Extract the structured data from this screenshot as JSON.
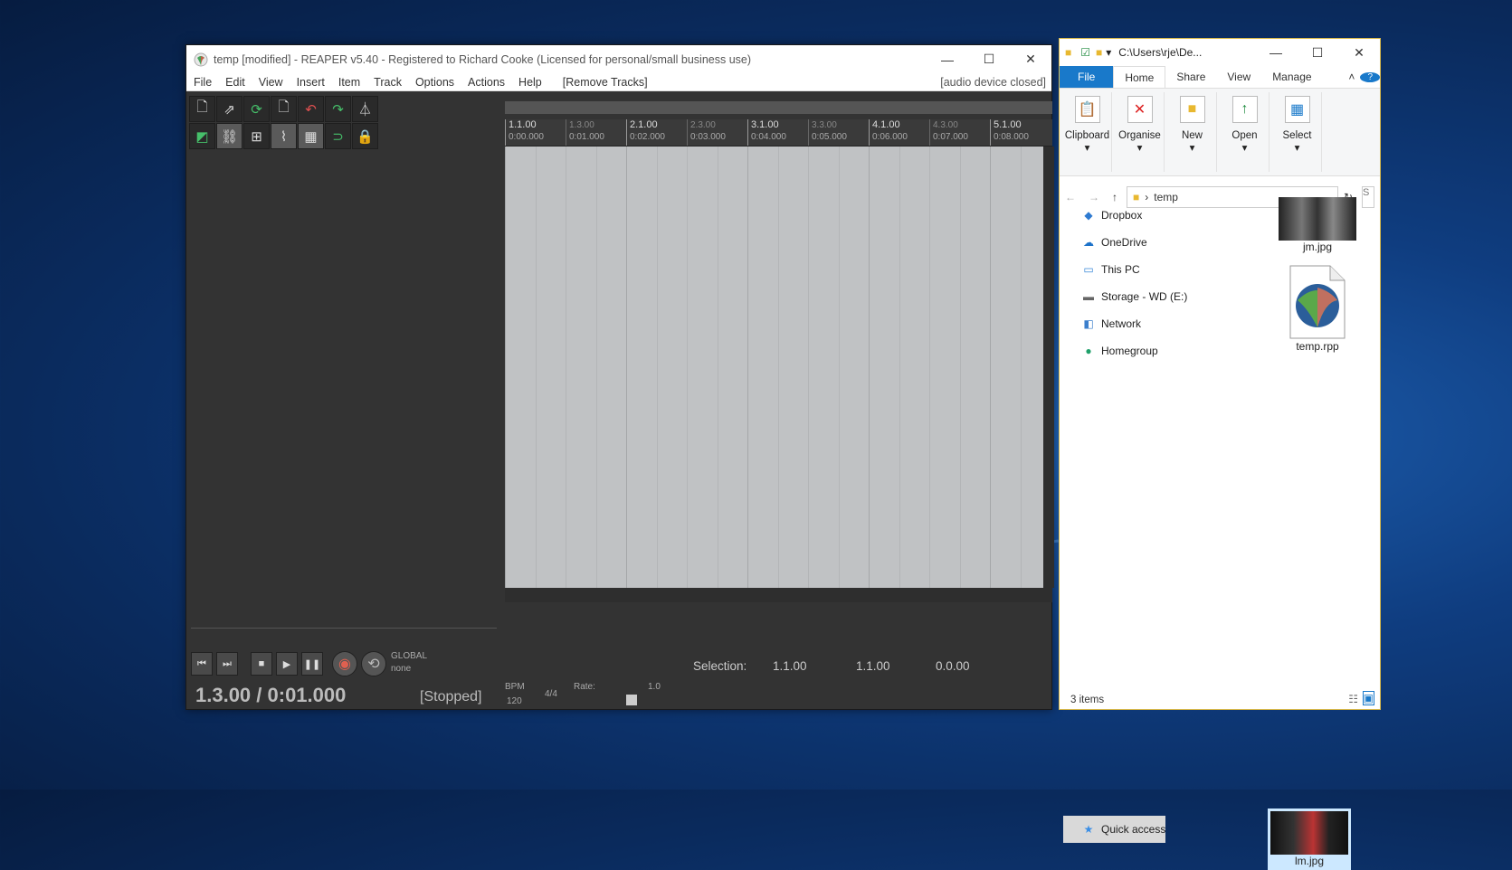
{
  "reaper": {
    "title": "temp [modified] - REAPER v5.40 - Registered to Richard Cooke (Licensed for personal/small business use)",
    "menu": [
      "File",
      "Edit",
      "View",
      "Insert",
      "Item",
      "Track",
      "Options",
      "Actions",
      "Help"
    ],
    "remove_tracks": "[Remove Tracks]",
    "audio_device": "[audio device closed]",
    "ruler": [
      {
        "bar": "1.1.00",
        "time": "0:00.000",
        "minor": false
      },
      {
        "bar": "1.3.00",
        "time": "0:01.000",
        "minor": true
      },
      {
        "bar": "2.1.00",
        "time": "0:02.000",
        "minor": false
      },
      {
        "bar": "2.3.00",
        "time": "0:03.000",
        "minor": true
      },
      {
        "bar": "3.1.00",
        "time": "0:04.000",
        "minor": false
      },
      {
        "bar": "3.3.00",
        "time": "0:05.000",
        "minor": true
      },
      {
        "bar": "4.1.00",
        "time": "0:06.000",
        "minor": false
      },
      {
        "bar": "4.3.00",
        "time": "0:07.000",
        "minor": true
      },
      {
        "bar": "5.1.00",
        "time": "0:08.000",
        "minor": false
      }
    ],
    "position": "1.3.00 / 0:01.000",
    "state": "[Stopped]",
    "global_label": "GLOBAL",
    "global_value": "none",
    "bpm_label": "BPM",
    "bpm": "120",
    "time_sig": "4/4",
    "rate_label": "Rate:",
    "rate": "1.0",
    "selection_label": "Selection:",
    "sel_start": "1.1.00",
    "sel_end": "1.1.00",
    "sel_len": "0.0.00"
  },
  "explorer": {
    "path": "C:\\Users\\rje\\De...",
    "tabs": [
      "File",
      "Home",
      "Share",
      "View",
      "Manage"
    ],
    "ribbon": [
      "Clipboard",
      "Organise",
      "New",
      "Open",
      "Select"
    ],
    "address": "temp",
    "nav": [
      {
        "label": "Quick access",
        "icon": "star-icon",
        "glyph": "★",
        "color": "#3a8ee6"
      },
      {
        "label": "Dropbox",
        "icon": "dropbox-icon",
        "glyph": "◆",
        "color": "#2e7ad1"
      },
      {
        "label": "OneDrive",
        "icon": "cloud-icon",
        "glyph": "☁",
        "color": "#1c72c9"
      },
      {
        "label": "This PC",
        "icon": "computer-icon",
        "glyph": "▭",
        "color": "#3b88d8"
      },
      {
        "label": "Storage - WD (E:)",
        "icon": "drive-icon",
        "glyph": "▬",
        "color": "#666666"
      },
      {
        "label": "Network",
        "icon": "network-icon",
        "glyph": "◧",
        "color": "#3b7fcc"
      },
      {
        "label": "Homegroup",
        "icon": "homegroup-icon",
        "glyph": "●",
        "color": "#1fa06a"
      }
    ],
    "files": [
      "jm.jpg",
      "lm.jpg",
      "temp.rpp"
    ],
    "status": "3 items"
  },
  "colors": {
    "accent": "#1979ca",
    "reaper_bg": "#333333",
    "arrange": "#c0c2c4"
  }
}
